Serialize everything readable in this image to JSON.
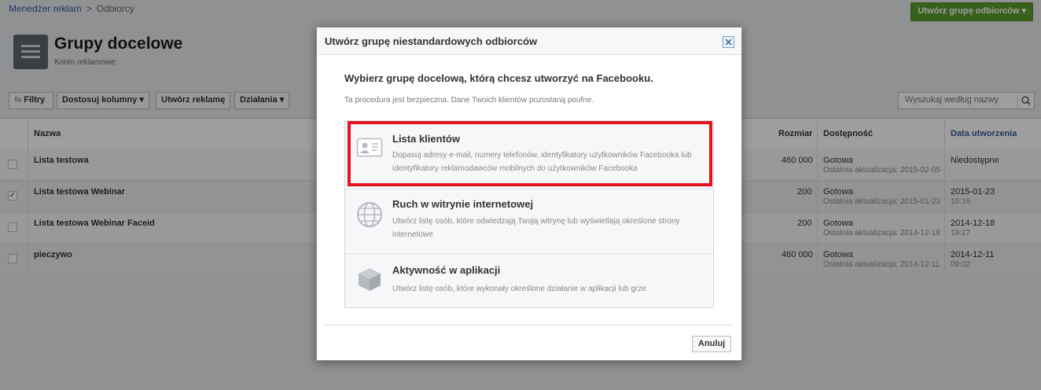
{
  "breadcrumb": {
    "root": "Menedżer reklam",
    "separator": ">",
    "current": "Odbiorcy"
  },
  "top_button": "Utwórz grupę odbiorców ▾",
  "header": {
    "title": "Grupy docelowe",
    "subtitle": "Konto reklamowe:"
  },
  "toolbar": {
    "filters": "Filtry",
    "columns": "Dostosuj kolumny ▾",
    "create_ad": "Utwórz reklamę",
    "actions": "Działania ▾"
  },
  "search": {
    "placeholder": "Wyszukaj według nazwy"
  },
  "table": {
    "headers": {
      "name": "Nazwa",
      "size": "Rozmiar",
      "availability": "Dostępność",
      "created": "Data utworzenia"
    },
    "rows": [
      {
        "checked": false,
        "name": "Lista testowa",
        "size": "460 000",
        "status": "Gotowa",
        "updated": "Ostatnia aktualizacja: 2015-02-05",
        "date": "Niedostępne",
        "time": ""
      },
      {
        "checked": true,
        "name": "Lista testowa Webinar",
        "size": "200",
        "status": "Gotowa",
        "updated": "Ostatnia aktualizacja: 2015-01-23",
        "date": "2015-01-23",
        "time": "10:16"
      },
      {
        "checked": false,
        "name": "Lista testowa Webinar Faceid",
        "size": "200",
        "status": "Gotowa",
        "updated": "Ostatnia aktualizacja: 2014-12-18",
        "date": "2014-12-18",
        "time": "19:27"
      },
      {
        "checked": false,
        "name": "pieczywo",
        "size": "460 000",
        "status": "Gotowa",
        "updated": "Ostatnia aktualizacja: 2014-12-11",
        "date": "2014-12-11",
        "time": "09:02"
      }
    ]
  },
  "modal": {
    "title": "Utwórz grupę niestandardowych odbiorców",
    "heading": "Wybierz grupę docelową, którą chcesz utworzyć na Facebooku.",
    "note": "Ta procedura jest bezpieczna. Dane Twoich klientów pozostaną poufne.",
    "options": [
      {
        "title": "Lista klientów",
        "desc": "Dopasuj adresy e-mail, numery telefonów, identyfikatory użytkowników Facebooka lub identyfikatory reklamodawców mobilnych do użytkowników Facebooka",
        "icon": "contact-card-icon"
      },
      {
        "title": "Ruch w witrynie internetowej",
        "desc": "Utwórz listę osób, które odwiedzają Twoją witrynę lub wyświetlają określone strony internetowe",
        "icon": "globe-icon"
      },
      {
        "title": "Aktywność w aplikacji",
        "desc": "Utwórz listę osób, które wykonały określone działanie w aplikacji lub grze",
        "icon": "cube-icon"
      }
    ],
    "cancel": "Anuluj"
  },
  "colors": {
    "primary_green": "#5b9d2e",
    "link_blue": "#3b5998",
    "highlight_red": "#e3141f"
  }
}
